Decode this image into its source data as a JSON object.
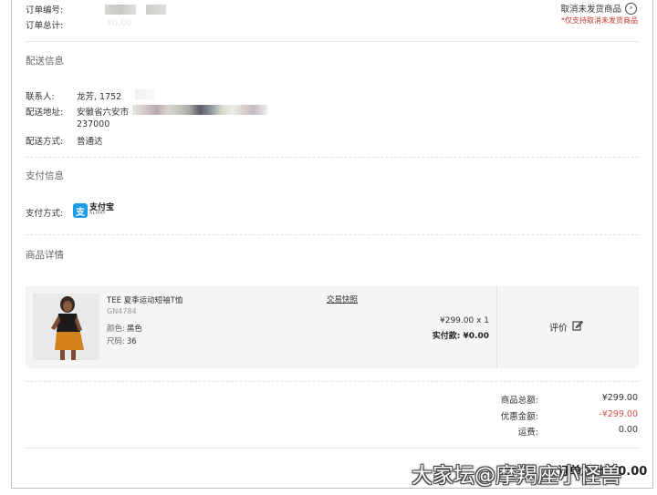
{
  "order": {
    "number_label": "订单编号:",
    "total_label": "订单总计:",
    "total_value": "¥0.00",
    "cancel_label": "取消未发货商品",
    "cancel_note": "*仅支持取消未发货商品"
  },
  "shipping": {
    "title": "配送信息",
    "contact_label": "联系人:",
    "contact_value": "龙芳, 1752",
    "address_label": "配送地址:",
    "address_value": "安徽省六安市",
    "postcode": "237000",
    "method_label": "配送方式:",
    "method_value": "普通达"
  },
  "payment": {
    "title": "支付信息",
    "method_label": "支付方式:",
    "alipay_cn": "支付宝",
    "alipay_en": "ALIPAY",
    "alipay_icon": "alipay-icon"
  },
  "products": {
    "title": "商品详情",
    "items": [
      {
        "name": "TEE 夏季运动短袖T恤",
        "code": "GN4784",
        "color_label": "颜色:",
        "color_value": "黑色",
        "size_label": "尺码:",
        "size_value": "36",
        "snapshot_label": "交易快照",
        "price_qty": "¥299.00  x  1",
        "paid_label": "实付款:",
        "paid_value": "¥0.00",
        "review_label": "评价",
        "review_icon": "edit-icon"
      }
    ]
  },
  "summary": {
    "goods_total_label": "商品总额:",
    "goods_total_value": "¥299.00",
    "discount_label": "优惠金额:",
    "discount_value": "-¥299.00",
    "shipping_label": "运费:",
    "shipping_value": "0.00",
    "total_label": "订单总计:",
    "total_value": "¥0.00"
  },
  "watermark": "大家坛@摩羯座小怪兽",
  "colors": {
    "accent_red": "#d9534f",
    "alipay_blue": "#1e9be8"
  }
}
